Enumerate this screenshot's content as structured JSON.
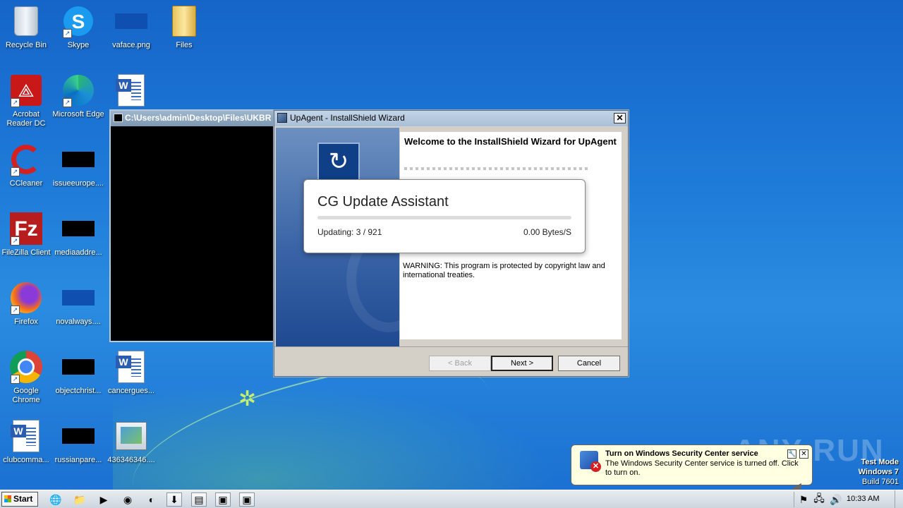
{
  "desktop": {
    "icons": [
      {
        "label": "Recycle Bin",
        "icon": "recycle-bin-icon"
      },
      {
        "label": "Skype",
        "icon": "skype-icon"
      },
      {
        "label": "vaface.png",
        "icon": "image-file-icon"
      },
      {
        "label": "Files",
        "icon": "folder-icon"
      },
      {
        "label": "Acrobat Reader DC",
        "icon": "acrobat-icon"
      },
      {
        "label": "Microsoft Edge",
        "icon": "edge-icon"
      },
      {
        "label": "",
        "icon": "word-document-icon"
      },
      {
        "label": "CCleaner",
        "icon": "ccleaner-icon"
      },
      {
        "label": "issueeurope....",
        "icon": "file-icon"
      },
      {
        "label": "FileZilla Client",
        "icon": "filezilla-icon"
      },
      {
        "label": "mediaaddre...",
        "icon": "file-icon"
      },
      {
        "label": "Firefox",
        "icon": "firefox-icon"
      },
      {
        "label": "novalways....",
        "icon": "file-icon"
      },
      {
        "label": "Google Chrome",
        "icon": "chrome-icon"
      },
      {
        "label": "objectchrist...",
        "icon": "file-icon"
      },
      {
        "label": "cancergues...",
        "icon": "word-document-icon"
      },
      {
        "label": "clubcomma...",
        "icon": "word-document-icon"
      },
      {
        "label": "russianpare...",
        "icon": "file-icon"
      },
      {
        "label": "436346346....",
        "icon": "executable-icon"
      }
    ]
  },
  "console": {
    "title": "C:\\Users\\admin\\Desktop\\Files\\UKBR"
  },
  "wizard": {
    "title": "UpAgent - InstallShield Wizard",
    "close_label": "✕",
    "heading": "Welcome to the InstallShield Wizard for UpAgent",
    "warning": "WARNING: This program is protected by copyright law and international treaties.",
    "buttons": {
      "back": "< Back",
      "next": "Next >",
      "cancel": "Cancel"
    }
  },
  "update_popup": {
    "title": "CG Update Assistant",
    "status": "Updating: 3 / 921",
    "speed": "0.00 Bytes/S",
    "progress_fraction": 0
  },
  "balloon": {
    "title": "Turn on Windows Security Center service",
    "text": "The Windows Security Center service is turned off. Click to turn on.",
    "close_label": "✕"
  },
  "watermark": {
    "text": "ANY RUN"
  },
  "system_info": {
    "mode": "Test Mode",
    "os": "Windows 7",
    "build": "Build 7601"
  },
  "taskbar": {
    "start_label": "Start",
    "clock": "10:33 AM"
  },
  "colors": {
    "desktop_blue": "#1e7ad8",
    "wizard_sidebar": "#3a64a6",
    "balloon_bg": "#ffffe1"
  }
}
